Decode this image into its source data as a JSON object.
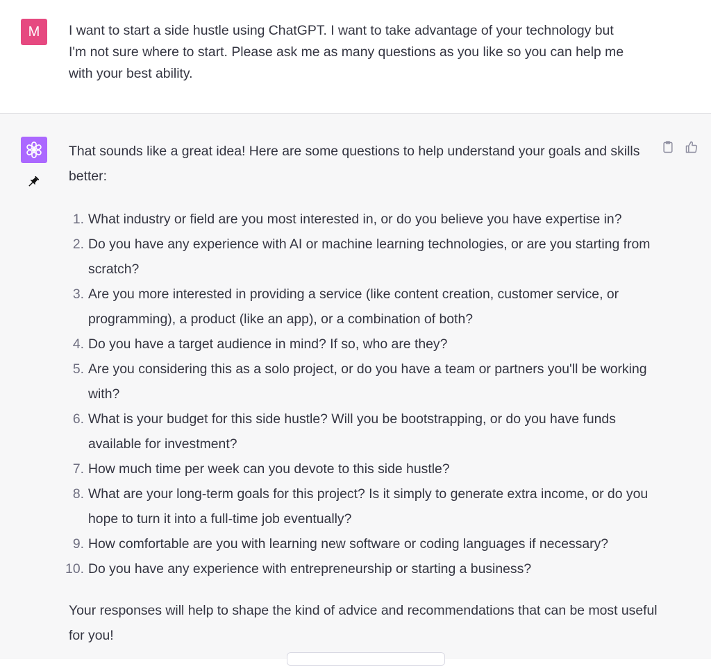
{
  "user_message": {
    "avatar_initial": "M",
    "avatar_color": "#e64980",
    "text": "I want to start a side hustle using ChatGPT. I want to take advantage of your technology but\nI'm not sure where to start. Please ask me as many questions as you like so you can help me\nwith your best ability."
  },
  "assistant_message": {
    "avatar_icon": "openai-logo-icon",
    "avatar_color": "#ab68ff",
    "intro": "That sounds like a great idea! Here are some questions to help understand your goals and skills better:",
    "questions": [
      {
        "num": "1.",
        "text": "What industry or field are you most interested in, or do you believe you have expertise in?"
      },
      {
        "num": "2.",
        "text": "Do you have any experience with AI or machine learning technologies, or are you starting from scratch?"
      },
      {
        "num": "3.",
        "text": "Are you more interested in providing a service (like content creation, customer service, or programming), a product (like an app), or a combination of both?"
      },
      {
        "num": "4.",
        "text": "Do you have a target audience in mind? If so, who are they?"
      },
      {
        "num": "5.",
        "text": "Are you considering this as a solo project, or do you have a team or partners you'll be working with?"
      },
      {
        "num": "6.",
        "text": "What is your budget for this side hustle? Will you be bootstrapping, or do you have funds available for investment?"
      },
      {
        "num": "7.",
        "text": "How much time per week can you devote to this side hustle?"
      },
      {
        "num": "8.",
        "text": "What are your long-term goals for this project? Is it simply to generate extra income, or do you hope to turn it into a full-time job eventually?"
      },
      {
        "num": "9.",
        "text": "How comfortable are you with learning new software or coding languages if necessary?"
      },
      {
        "num": "10.",
        "text": "Do you have any experience with entrepreneurship or starting a business?"
      }
    ],
    "outro": "Your responses will help to shape the kind of advice and recommendations that can be most useful for you!",
    "actions": [
      "copy-icon",
      "thumbs-up-icon"
    ],
    "pin_icon": "pin-icon"
  }
}
